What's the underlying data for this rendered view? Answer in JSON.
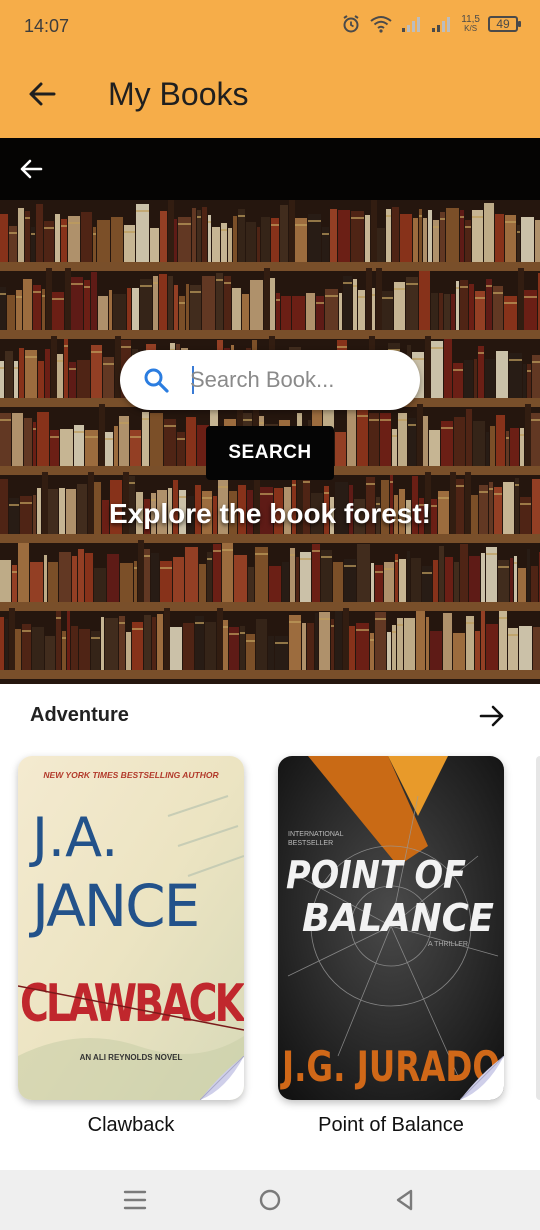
{
  "status_bar": {
    "time": "14:07",
    "speed_value": "11,5",
    "speed_unit": "K/S",
    "battery": "49"
  },
  "app_bar": {
    "title": "My Books",
    "back_icon": "arrow-left-icon"
  },
  "hero": {
    "back_icon": "arrow-left-icon",
    "search": {
      "placeholder": "Search Book...",
      "value": ""
    },
    "search_button_label": "SEARCH",
    "tagline": "Explore the book forest!"
  },
  "category": {
    "title": "Adventure",
    "arrow_icon": "arrow-right-icon",
    "books": [
      {
        "title": "Clawback",
        "cover": {
          "top_line": "NEW YORK TIMES BESTSELLING AUTHOR",
          "author_line1": "J.A.",
          "author_line2": "JANCE",
          "big_title": "CLAWBACK",
          "bottom_line": "AN ALI REYNOLDS NOVEL"
        }
      },
      {
        "title": "Point of Balance",
        "cover": {
          "top_line1": "INTERNATIONAL",
          "top_line2": "BESTSELLER",
          "title_line1": "POINT OF",
          "title_line2": "BALANCE",
          "sub": "A THRILLER",
          "author": "J.G. JURADO"
        }
      }
    ]
  },
  "nav_bar": {
    "icons": [
      "menu-icon",
      "home-icon",
      "back-triangle-icon"
    ]
  },
  "colors": {
    "app_bar": "#f6ad49",
    "search_button": "#050505"
  }
}
